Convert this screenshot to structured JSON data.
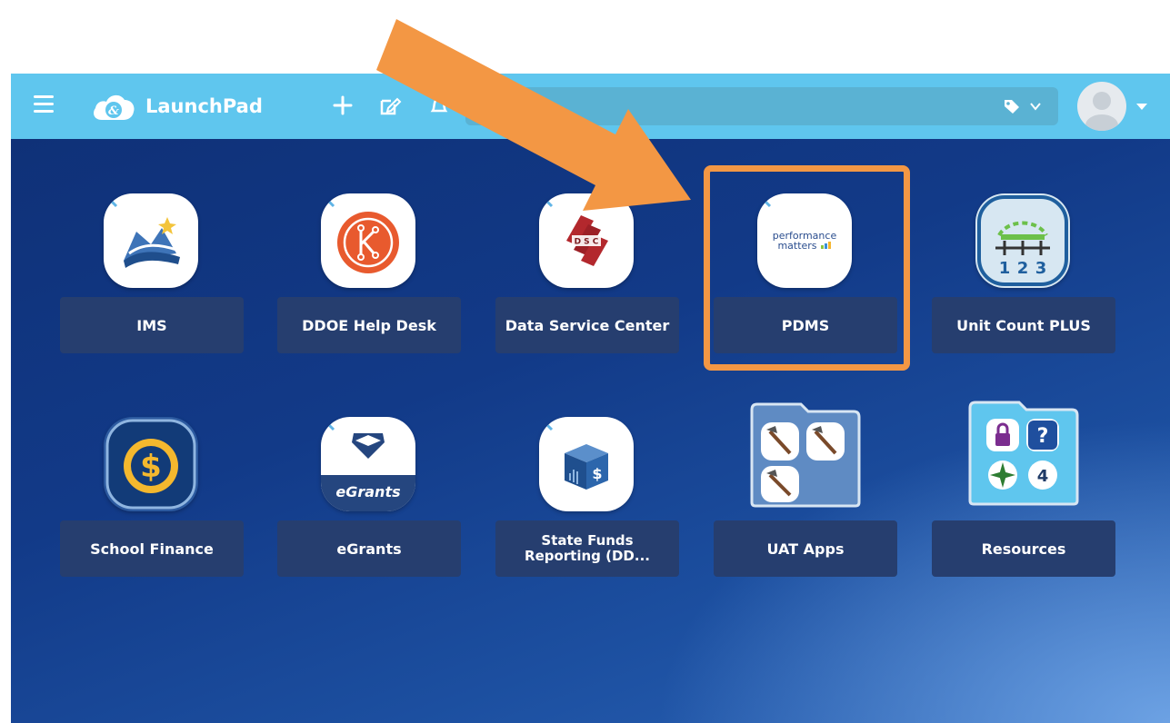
{
  "header": {
    "app_name": "LaunchPad",
    "search_placeholder": "",
    "colors": {
      "topbar": "#5fc6ee",
      "search": "#5ab2d3"
    }
  },
  "tiles": [
    {
      "label": "IMS",
      "icon": "ims-icon"
    },
    {
      "label": "DDOE Help Desk",
      "icon": "k-circle-icon"
    },
    {
      "label": "Data Service Center",
      "icon": "dsc-icon"
    },
    {
      "label": "PDMS",
      "icon": "performance-matters-icon",
      "logo_text": [
        "performance",
        "matters"
      ]
    },
    {
      "label": "Unit Count PLUS",
      "icon": "unit-count-icon",
      "numbers": [
        "1",
        "2",
        "3"
      ]
    },
    {
      "label": "School Finance",
      "icon": "dollar-coin-icon"
    },
    {
      "label": "eGrants",
      "icon": "egrants-icon",
      "logo_text": "eGrants"
    },
    {
      "label_line1": "State Funds",
      "label_line2": "Reporting (DD...",
      "icon": "money-cube-icon"
    },
    {
      "label": "UAT Apps",
      "icon": "folder-hammers-icon"
    },
    {
      "label": "Resources",
      "icon": "folder-resources-icon",
      "badge": "4"
    }
  ],
  "annotation": {
    "color": "#f39744",
    "target": "PDMS"
  }
}
